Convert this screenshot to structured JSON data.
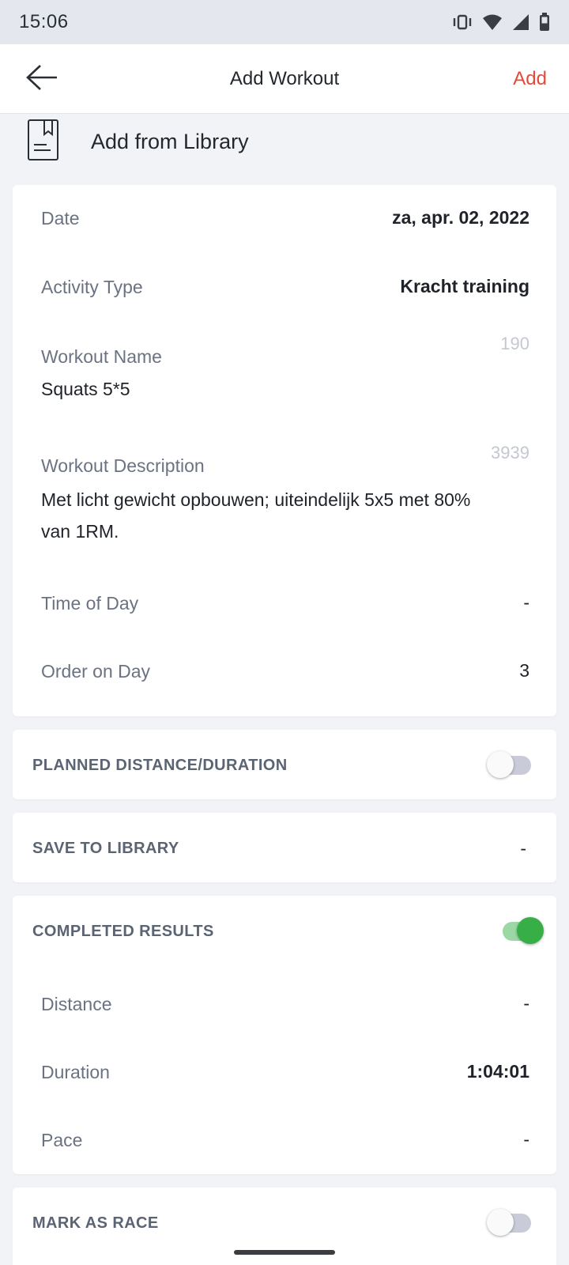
{
  "status_bar": {
    "time": "15:06",
    "icons": [
      "vibrate-icon",
      "wifi-icon",
      "signal-icon",
      "battery-icon"
    ]
  },
  "app_bar": {
    "back_icon": "arrow-left-icon",
    "title": "Add Workout",
    "add_label": "Add"
  },
  "library": {
    "icon": "document-bookmark-icon",
    "label": "Add from Library"
  },
  "workout": {
    "date_label": "Date",
    "date_value": "za, apr. 02, 2022",
    "activity_label": "Activity Type",
    "activity_value": "Kracht training",
    "name_label": "Workout Name",
    "name_counter": "190",
    "name_value": "Squats 5*5",
    "description_label": "Workout Description",
    "description_counter": "3939",
    "description_line1": "Met licht gewicht opbouwen; uiteindelijk 5x5 met 80%",
    "description_line2": "van 1RM.",
    "time_label": "Time of Day",
    "time_value": "-",
    "order_label": "Order on Day",
    "order_value": "3"
  },
  "planned": {
    "label": "PLANNED DISTANCE/DURATION",
    "enabled": false
  },
  "save_library": {
    "label": "SAVE TO LIBRARY",
    "value": "-"
  },
  "completed": {
    "label": "COMPLETED RESULTS",
    "enabled": true,
    "distance_label": "Distance",
    "distance_value": "-",
    "duration_label": "Duration",
    "duration_value": "1:04:01",
    "pace_label": "Pace",
    "pace_value": "-"
  },
  "race": {
    "label": "MARK AS RACE",
    "enabled": false
  },
  "colors": {
    "accent_red": "#e34a3a",
    "toggle_on": "#38ae47",
    "background": "#f2f3f6"
  }
}
